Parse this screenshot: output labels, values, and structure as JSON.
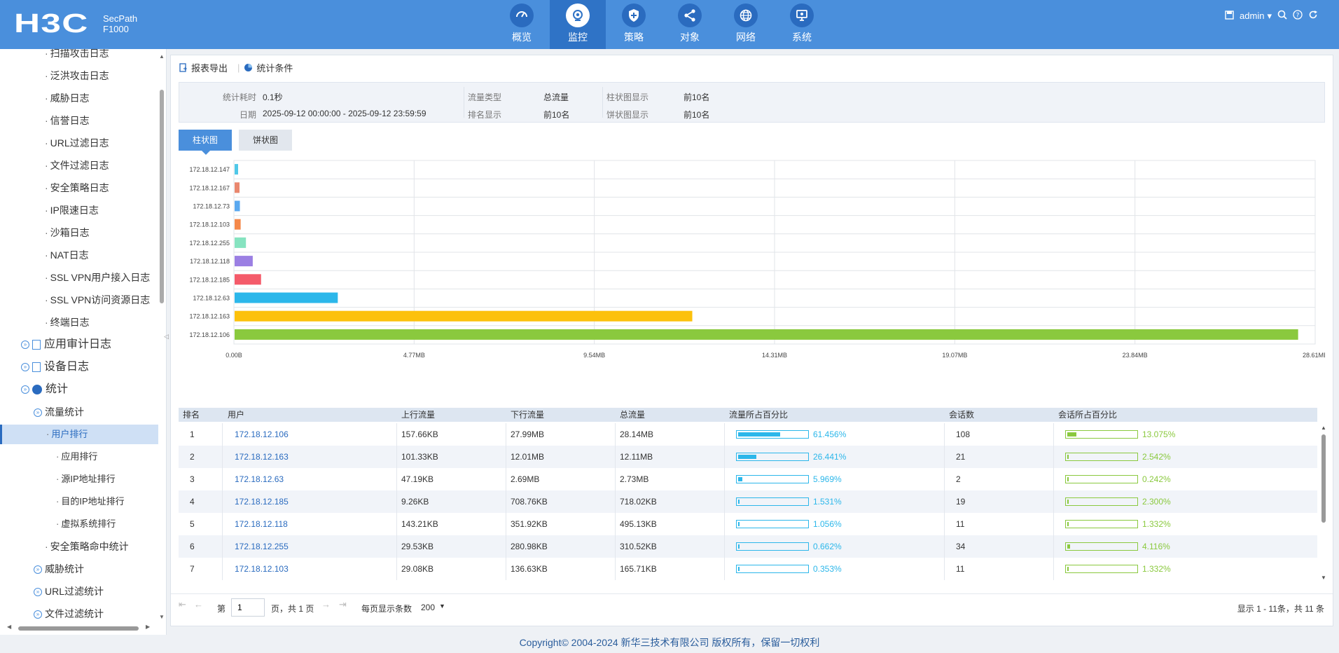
{
  "header": {
    "brand": "H3C",
    "product_line1": "SecPath",
    "product_line2": "F1000",
    "nav": [
      {
        "label": "概览",
        "icon": "gauge-icon"
      },
      {
        "label": "监控",
        "icon": "monitor-camera-icon",
        "active": true
      },
      {
        "label": "策略",
        "icon": "shield-icon"
      },
      {
        "label": "对象",
        "icon": "share-nodes-icon"
      },
      {
        "label": "网络",
        "icon": "globe-icon"
      },
      {
        "label": "系统",
        "icon": "system-screen-icon"
      }
    ],
    "user": "admin"
  },
  "sidebar": {
    "items": [
      {
        "label": "扫描攻击日志"
      },
      {
        "label": "泛洪攻击日志"
      },
      {
        "label": "威胁日志"
      },
      {
        "label": "信誉日志"
      },
      {
        "label": "URL过滤日志"
      },
      {
        "label": "文件过滤日志"
      },
      {
        "label": "安全策略日志"
      },
      {
        "label": "IP限速日志"
      },
      {
        "label": "沙箱日志"
      },
      {
        "label": "NAT日志"
      },
      {
        "label": "SSL VPN用户接入日志"
      },
      {
        "label": "SSL VPN访问资源日志"
      },
      {
        "label": "终端日志"
      },
      {
        "label": "应用审计日志"
      },
      {
        "label": "设备日志"
      },
      {
        "label": "统计"
      },
      {
        "label": "流量统计"
      },
      {
        "label": "用户排行"
      },
      {
        "label": "应用排行"
      },
      {
        "label": "源IP地址排行"
      },
      {
        "label": "目的IP地址排行"
      },
      {
        "label": "虚拟系统排行"
      },
      {
        "label": "安全策略命中统计"
      },
      {
        "label": "威胁统计"
      },
      {
        "label": "URL过滤统计"
      },
      {
        "label": "文件过滤统计"
      }
    ]
  },
  "toolbar": {
    "export_label": "报表导出",
    "condition_label": "统计条件"
  },
  "summary": {
    "cost_label": "统计耗时",
    "cost_value": "0.1秒",
    "date_label": "日期",
    "date_value": "2025-09-12 00:00:00 - 2025-09-12 23:59:59",
    "traffic_type_label": "流量类型",
    "traffic_type_value": "总流量",
    "rank_label": "排名显示",
    "rank_value": "前10名",
    "bar_label": "柱状图显示",
    "bar_value": "前10名",
    "pie_label": "饼状图显示",
    "pie_value": "前10名"
  },
  "tabs": {
    "bar": "柱状图",
    "pie": "饼状图"
  },
  "chart_data": {
    "type": "bar",
    "orientation": "horizontal",
    "categories": [
      "172.18.12.147",
      "172.18.12.167",
      "172.18.12.73",
      "172.18.12.103",
      "172.18.12.255",
      "172.18.12.118",
      "172.18.12.185",
      "172.18.12.63",
      "172.18.12.163",
      "172.18.12.106"
    ],
    "values": [
      0.09,
      0.13,
      0.14,
      0.16,
      0.3,
      0.48,
      0.7,
      2.73,
      12.11,
      28.14
    ],
    "colors": [
      "#4fc8e8",
      "#e9876e",
      "#5aa8ef",
      "#f4884a",
      "#86e3c0",
      "#9b7fe3",
      "#f45b6a",
      "#2cb7ea",
      "#fcc10c",
      "#8ac93e"
    ],
    "unit": "MB",
    "xticks": [
      "0.00B",
      "4.77MB",
      "9.54MB",
      "14.31MB",
      "19.07MB",
      "23.84MB",
      "28.61MB"
    ],
    "xlim": [
      0,
      28.61
    ],
    "grid": true
  },
  "table": {
    "headers": [
      "排名",
      "用户",
      "上行流量",
      "下行流量",
      "总流量",
      "流量所占百分比",
      "会话数",
      "会话所占百分比"
    ],
    "rows": [
      {
        "rank": "1",
        "user": "172.18.12.106",
        "up": "157.66KB",
        "down": "27.99MB",
        "total": "28.14MB",
        "pct": "61.456%",
        "pct_v": 61.456,
        "sess": "108",
        "spct": "13.075%",
        "spct_v": 13.075
      },
      {
        "rank": "2",
        "user": "172.18.12.163",
        "up": "101.33KB",
        "down": "12.01MB",
        "total": "12.11MB",
        "pct": "26.441%",
        "pct_v": 26.441,
        "sess": "21",
        "spct": "2.542%",
        "spct_v": 2.542
      },
      {
        "rank": "3",
        "user": "172.18.12.63",
        "up": "47.19KB",
        "down": "2.69MB",
        "total": "2.73MB",
        "pct": "5.969%",
        "pct_v": 5.969,
        "sess": "2",
        "spct": "0.242%",
        "spct_v": 0.242
      },
      {
        "rank": "4",
        "user": "172.18.12.185",
        "up": "9.26KB",
        "down": "708.76KB",
        "total": "718.02KB",
        "pct": "1.531%",
        "pct_v": 1.531,
        "sess": "19",
        "spct": "2.300%",
        "spct_v": 2.3
      },
      {
        "rank": "5",
        "user": "172.18.12.118",
        "up": "143.21KB",
        "down": "351.92KB",
        "total": "495.13KB",
        "pct": "1.056%",
        "pct_v": 1.056,
        "sess": "11",
        "spct": "1.332%",
        "spct_v": 1.332
      },
      {
        "rank": "6",
        "user": "172.18.12.255",
        "up": "29.53KB",
        "down": "280.98KB",
        "total": "310.52KB",
        "pct": "0.662%",
        "pct_v": 0.662,
        "sess": "34",
        "spct": "4.116%",
        "spct_v": 4.116
      },
      {
        "rank": "7",
        "user": "172.18.12.103",
        "up": "29.08KB",
        "down": "136.63KB",
        "total": "165.71KB",
        "pct": "0.353%",
        "pct_v": 0.353,
        "sess": "11",
        "spct": "1.332%",
        "spct_v": 1.332
      }
    ]
  },
  "pager": {
    "page_prefix": "第",
    "page_value": "1",
    "page_suffix": "页，共 1 页",
    "per_page_label": "每页显示条数",
    "per_page_value": "200",
    "summary": "显示 1 - 11条，共 11 条"
  },
  "footer": {
    "copyright": "Copyright© 2004-2024 新华三技术有限公司 版权所有，保留一切权利"
  }
}
